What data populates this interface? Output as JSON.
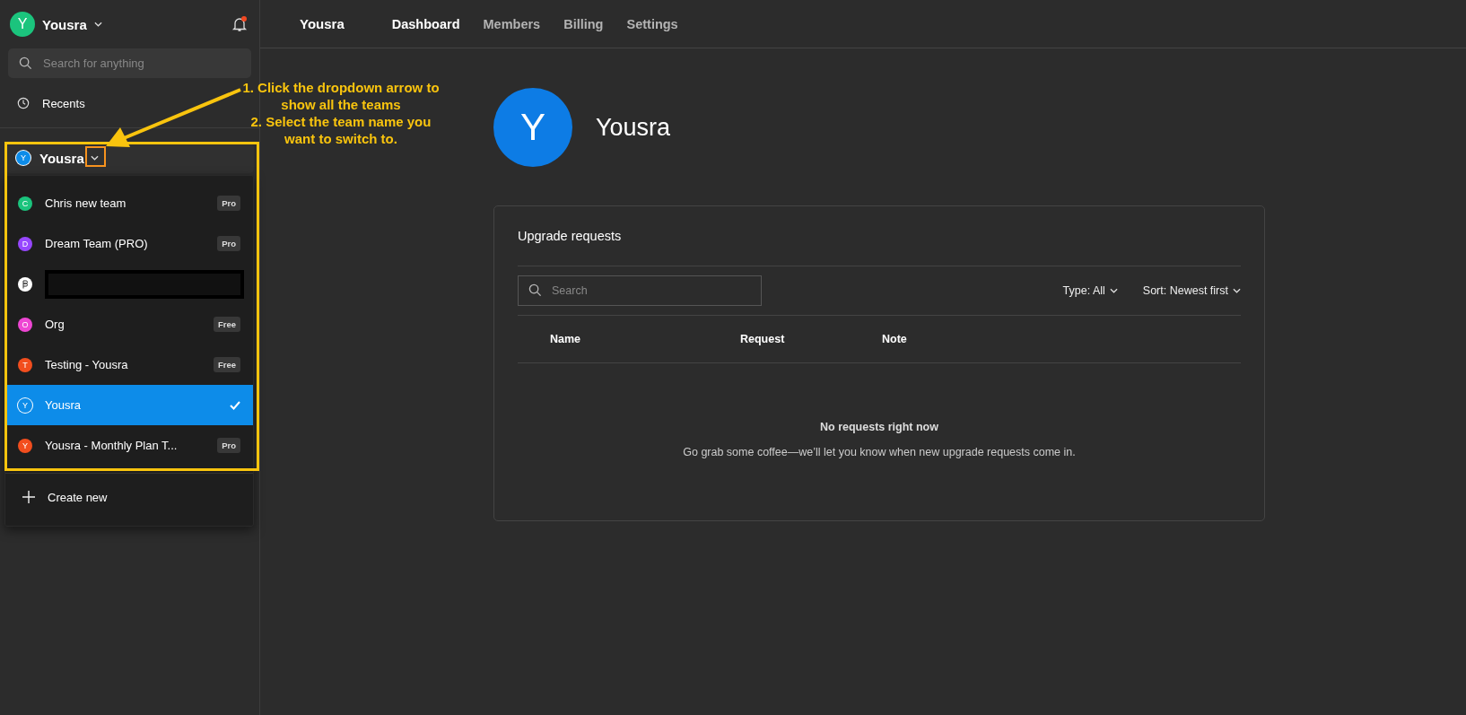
{
  "account": {
    "initial": "Y",
    "name": "Yousra",
    "has_notification": true
  },
  "search": {
    "placeholder": "Search for anything"
  },
  "recents": "Recents",
  "team_switcher": {
    "initial": "Y",
    "name": "Yousra",
    "expanded": true
  },
  "teams": [
    {
      "kind": "team",
      "initial": "C",
      "name": "Chris new team",
      "color": "#1bc47d",
      "plan": "Pro",
      "selected": false
    },
    {
      "kind": "team",
      "initial": "D",
      "name": "Dream Team (PRO)",
      "color": "#9747ff",
      "plan": "Pro",
      "selected": false
    },
    {
      "kind": "redacted",
      "selected": false
    },
    {
      "kind": "team",
      "initial": "O",
      "name": "Org",
      "color": "#ee46d3",
      "plan": "Free",
      "selected": false
    },
    {
      "kind": "team",
      "initial": "T",
      "name": "Testing - Yousra",
      "color": "#f24e1e",
      "plan": "Free",
      "selected": false
    },
    {
      "kind": "team",
      "initial": "Y",
      "name": "Yousra",
      "color": "#0d8ce9",
      "selected": true
    },
    {
      "kind": "team",
      "initial": "Y",
      "name": "Yousra - Monthly Plan T...",
      "color": "#f24e1e",
      "plan": "Pro",
      "selected": false
    }
  ],
  "create_new": "Create new",
  "header": {
    "team": "Yousra",
    "tabs": [
      {
        "label": "Dashboard",
        "selected": true
      },
      {
        "label": "Members",
        "selected": false
      },
      {
        "label": "Billing",
        "selected": false
      },
      {
        "label": "Settings",
        "selected": false
      }
    ]
  },
  "profile": {
    "initial": "Y",
    "name": "Yousra"
  },
  "upgrade_requests": {
    "title": "Upgrade requests",
    "search_placeholder": "Search",
    "filters": [
      "Type: All",
      "Sort: Newest first"
    ],
    "columns": [
      "Name",
      "Request",
      "Note"
    ],
    "empty_title": "No requests right now",
    "empty_text": "Go grab some coffee—we’ll let you know when new upgrade requests come in."
  },
  "annotation": {
    "lines": [
      "1. Click the dropdown arrow to",
      "show all the teams",
      "2. Select the team name you",
      "want to switch to."
    ]
  }
}
